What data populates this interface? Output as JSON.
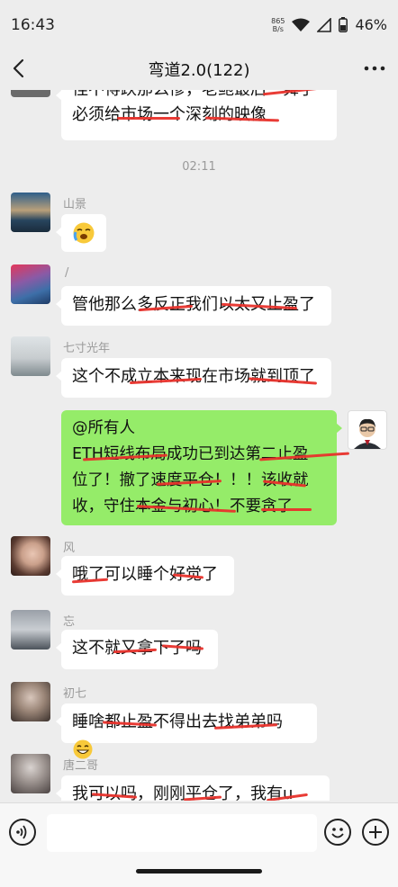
{
  "status": {
    "time": "16:43",
    "net_speed_top": "865",
    "net_speed_bottom": "B/s",
    "battery": "46%"
  },
  "nav": {
    "title": "弯道2.0(122)"
  },
  "messages": {
    "top_partial": {
      "line1": "怪不得跌那么惨，老鲍最后一舞了",
      "line2": "必须给市场一个深刻的映像"
    },
    "timestamp": "02:11",
    "m1": {
      "sender": "山景"
    },
    "m2": {
      "sender": "/",
      "text": "管他那么多反正我们以太又止盈了"
    },
    "m3": {
      "sender": "七寸光年",
      "text": "这个不成立本来现在市场就到顶了"
    },
    "m4": {
      "line1": "@所有人",
      "line2": "ETH短线布局成功已到达第二止盈",
      "line3": "位了！撤了速度平仓！！！该收就",
      "line4": "收，守住本金与初心！不要贪了"
    },
    "m5": {
      "sender": "风",
      "text": "哦了可以睡个好觉了"
    },
    "m6": {
      "sender": "忘",
      "text": "这不就又拿下了吗"
    },
    "m7": {
      "sender": "初七",
      "text": "睡啥都止盈不得出去找弟弟吗"
    },
    "m8": {
      "sender": "唐二哥",
      "text": "我可以吗，刚刚平仓了，我有u"
    }
  },
  "colors": {
    "self_bubble": "#95ec69",
    "strike": "#e8312b",
    "background": "#ededed"
  }
}
